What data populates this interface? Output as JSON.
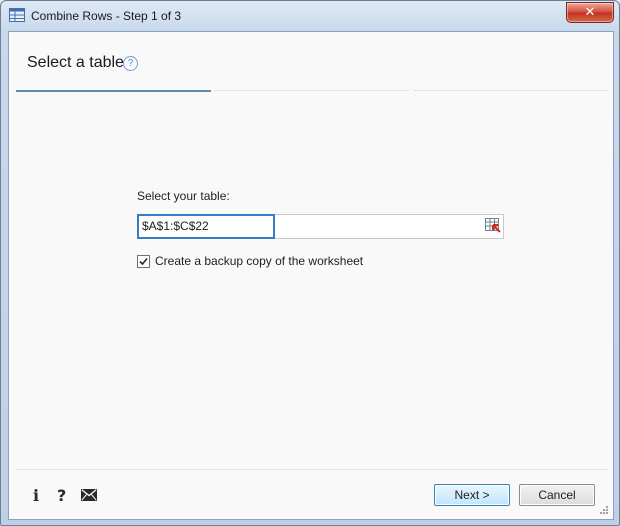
{
  "window": {
    "title": "Combine Rows - Step 1 of 3",
    "close_glyph": "✕"
  },
  "header": {
    "title": "Select a table",
    "help_glyph": "?"
  },
  "steps": {
    "count": 3,
    "active": 1
  },
  "form": {
    "table_label": "Select your table:",
    "table_range": "$A$1:$C$22",
    "backup_checkbox": {
      "label": "Create a backup copy of the worksheet",
      "checked": true
    }
  },
  "footer": {
    "icons": {
      "info": "i",
      "help": "?",
      "mail": "mail-icon"
    },
    "next_label": "Next >",
    "cancel_label": "Cancel"
  },
  "colors": {
    "accent": "#3a7cc2",
    "step_active": "#5a8fb0",
    "close_button": "#c0301f"
  }
}
